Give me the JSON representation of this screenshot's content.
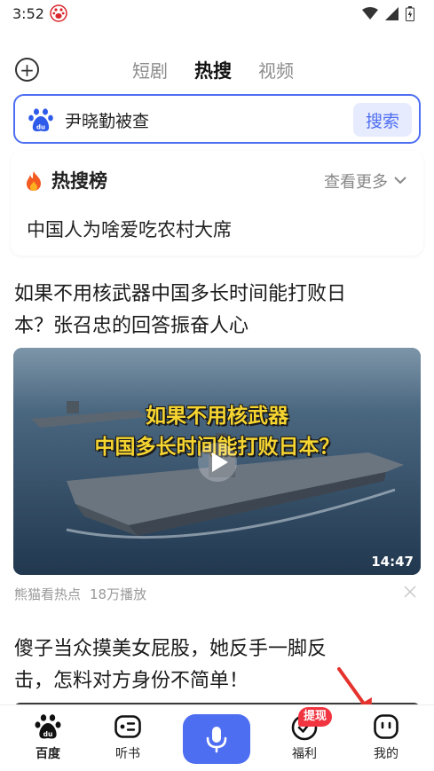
{
  "status_bar": {
    "time": "3:52"
  },
  "header": {
    "tabs": [
      {
        "label": "短剧",
        "active": false
      },
      {
        "label": "热搜",
        "active": true
      },
      {
        "label": "视频",
        "active": false
      }
    ]
  },
  "search": {
    "query": "尹晓勤被查",
    "button_label": "搜索"
  },
  "hot_list": {
    "title": "热搜榜",
    "more_label": "查看更多",
    "items": [
      "中国人为啥爱吃农村大席"
    ]
  },
  "feed": {
    "articles": [
      {
        "title_lines": [
          "如果不用核武器中国多长时间能打败日",
          "本？张召忠的回答振奋人心"
        ],
        "video_caption_lines": [
          "如果不用核武器",
          "中国多长时间能打败日本？"
        ],
        "duration": "14:47",
        "source": "熊猫看热点",
        "views": "18万播放"
      },
      {
        "title_lines": [
          "傻子当众摸美女屁股，她反手一脚反",
          "击，怎料对方身份不简单！"
        ]
      }
    ]
  },
  "bottom_nav": {
    "items": [
      {
        "label": "百度",
        "icon": "baidu-paw-icon",
        "active": true
      },
      {
        "label": "听书",
        "icon": "audiobook-icon",
        "active": false
      },
      {
        "label": "",
        "icon": "microphone-icon",
        "active": false
      },
      {
        "label": "福利",
        "icon": "welfare-icon",
        "active": false
      },
      {
        "label": "我的",
        "icon": "profile-icon",
        "active": false
      }
    ],
    "welfare_badge": "提现"
  },
  "colors": {
    "accent": "#4e6ef2",
    "badge": "#f1343f",
    "hot": "#f25a21",
    "annotation_arrow": "#e5322d"
  }
}
